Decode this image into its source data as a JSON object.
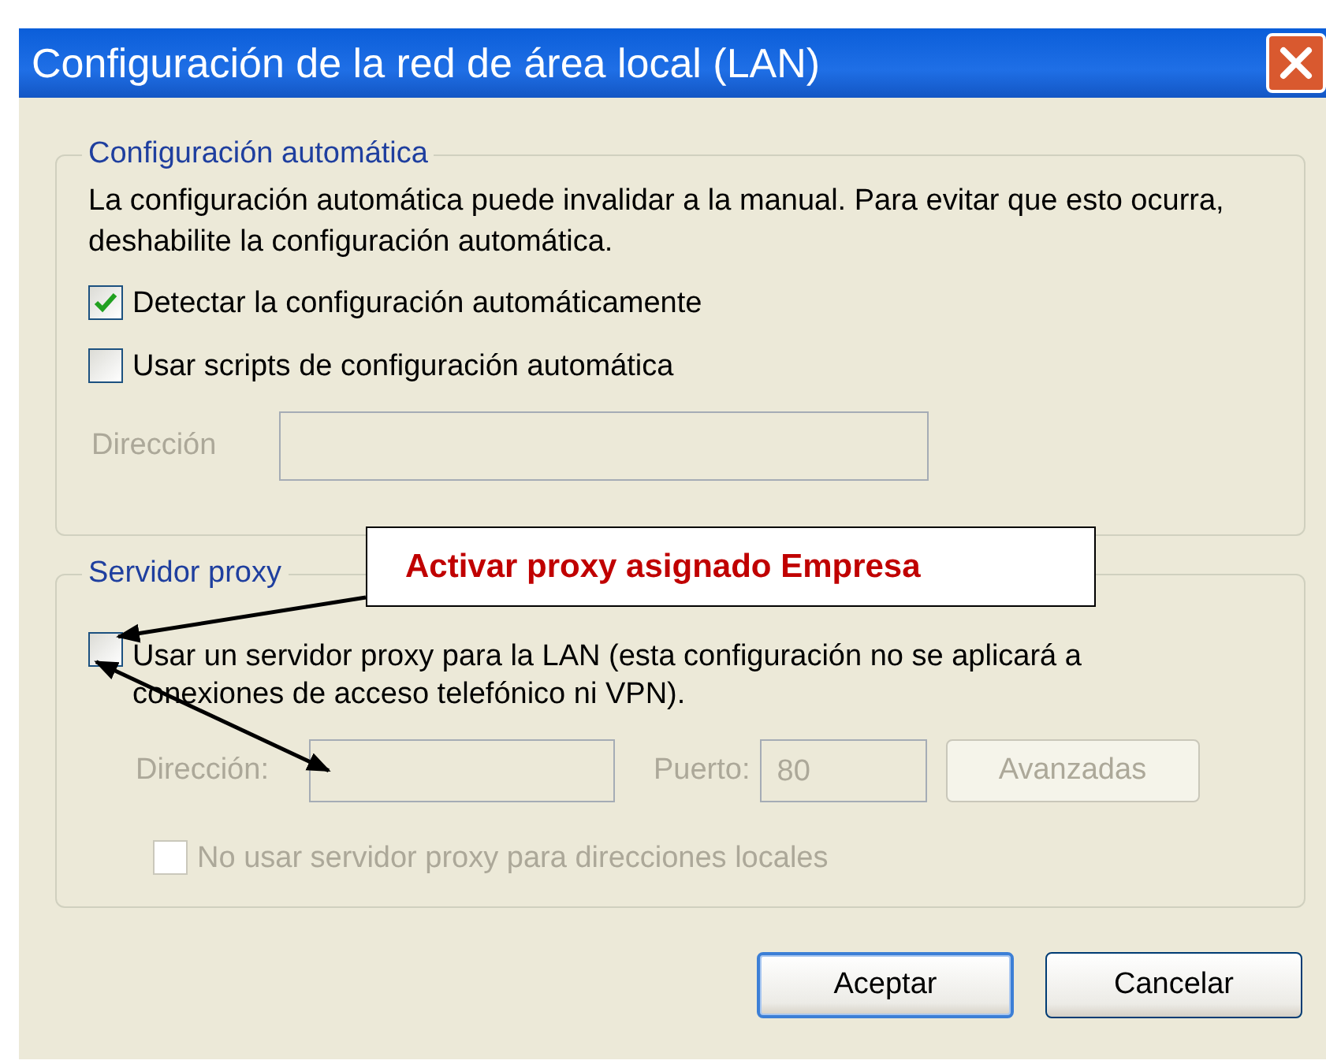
{
  "window": {
    "title": "Configuración de la red de área local (LAN)"
  },
  "automatic_group": {
    "legend": "Configuración automática",
    "description": "La configuración automática puede invalidar a la manual. Para evitar que esto ocurra, deshabilite la configuración automática.",
    "checkboxes": [
      {
        "label": "Detectar la configuración automáticamente",
        "checked": true,
        "disabled": false
      },
      {
        "label": "Usar scripts de configuración automática",
        "checked": false,
        "disabled": false
      }
    ],
    "address": {
      "label": "Dirección",
      "disabled": true
    }
  },
  "proxy_group": {
    "legend": "Servidor proxy",
    "use_proxy": {
      "label": "Usar un servidor proxy para la LAN (esta configuración no se aplicará a conexiones de acceso telefónico ni VPN).",
      "checked": false,
      "disabled": false
    },
    "address": {
      "label": "Dirección:",
      "disabled": true
    },
    "port": {
      "label": "Puerto:",
      "value": "80",
      "disabled": true
    },
    "advanced_button": {
      "label": "Avanzadas",
      "disabled": true
    },
    "bypass_local": {
      "label": "No usar servidor proxy para direcciones locales",
      "checked": false,
      "disabled": true
    }
  },
  "buttons": [
    {
      "label": "Aceptar",
      "default": true
    },
    {
      "label": "Cancelar",
      "default": false
    }
  ],
  "annotation": {
    "text": "Activar proxy asignado Empresa"
  }
}
